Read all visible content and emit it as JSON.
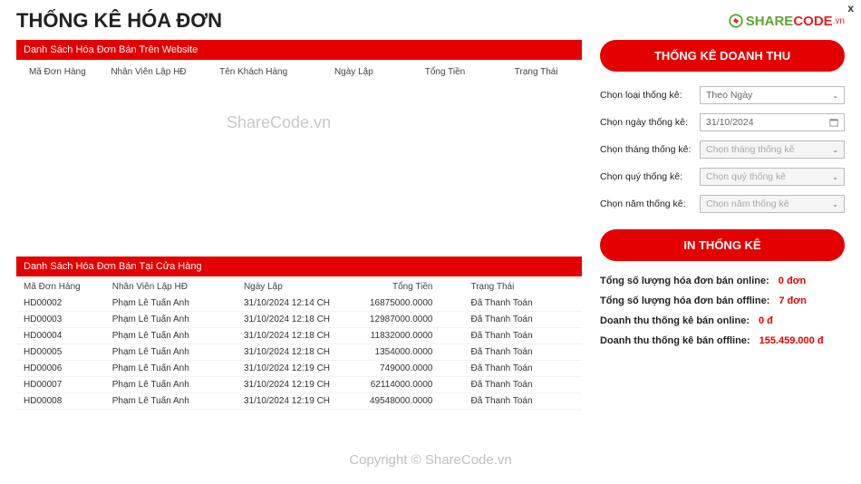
{
  "header": {
    "title": "THỐNG KÊ HÓA ĐƠN",
    "logo_green": "SHARE",
    "logo_red": "CODE",
    "logo_vn": ".vn"
  },
  "online_section": {
    "title": "Danh Sách Hóa Đơn Bán Trên Website",
    "columns": [
      "Mã Đơn Hàng",
      "Nhân Viên Lập HĐ",
      "Tên Khách Hàng",
      "Ngày Lập",
      "Tổng Tiền",
      "Trạng Thái"
    ]
  },
  "offline_section": {
    "title": "Danh Sách Hóa Đơn Bán Tại Cửa Hàng",
    "columns": [
      "Mã Đơn Hàng",
      "Nhân Viên Lập HĐ",
      "Ngày Lập",
      "Tổng Tiền",
      "Trạng Thái"
    ],
    "rows": [
      {
        "id": "HD00002",
        "staff": "Phạm Lê Tuấn Anh",
        "date": "31/10/2024 12:14 CH",
        "total": "16875000.0000",
        "status": "Đã Thanh Toán"
      },
      {
        "id": "HD00003",
        "staff": "Phạm Lê Tuấn Anh",
        "date": "31/10/2024 12:18 CH",
        "total": "12987000.0000",
        "status": "Đã Thanh Toán"
      },
      {
        "id": "HD00004",
        "staff": "Phạm Lê Tuấn Anh",
        "date": "31/10/2024 12:18 CH",
        "total": "11832000.0000",
        "status": "Đã Thanh Toán"
      },
      {
        "id": "HD00005",
        "staff": "Phạm Lê Tuấn Anh",
        "date": "31/10/2024 12:18 CH",
        "total": "1354000.0000",
        "status": "Đã Thanh Toán"
      },
      {
        "id": "HD00006",
        "staff": "Phạm Lê Tuấn Anh",
        "date": "31/10/2024 12:19 CH",
        "total": "749000.0000",
        "status": "Đã Thanh Toán"
      },
      {
        "id": "HD00007",
        "staff": "Phạm Lê Tuấn Anh",
        "date": "31/10/2024 12:19 CH",
        "total": "62114000.0000",
        "status": "Đã Thanh Toán"
      },
      {
        "id": "HD00008",
        "staff": "Phạm Lê Tuấn Anh",
        "date": "31/10/2024 12:19 CH",
        "total": "49548000.0000",
        "status": "Đã Thanh Toán"
      }
    ]
  },
  "right": {
    "btn_stats": "THỐNG KÊ DOANH THU",
    "btn_print": "IN THỐNG KÊ",
    "filters": {
      "type_label": "Chọn loại thống kê:",
      "type_value": "Theo Ngày",
      "date_label": "Chọn ngày thống kê:",
      "date_value": "31/10/2024",
      "month_label": "Chọn tháng thống kê:",
      "month_placeholder": "Chọn tháng thống kê",
      "quarter_label": "Chọn quý thống kê:",
      "quarter_placeholder": "Chọn quý thống kê",
      "year_label": "Chọn năm thống kê:",
      "year_placeholder": "Chọn năm thống kê"
    },
    "summary": {
      "online_count_label": "Tổng số lượng hóa đơn bán online:",
      "online_count_value": "0 đơn",
      "offline_count_label": "Tổng số lượng hóa đơn bán offline:",
      "offline_count_value": "7 đơn",
      "online_rev_label": "Doanh thu thống kê bán online:",
      "online_rev_value": "0 đ",
      "offline_rev_label": "Doanh thu thống kê bán offline:",
      "offline_rev_value": "155.459.000 đ"
    }
  },
  "watermark": "ShareCode.vn",
  "watermark2": "Copyright © ShareCode.vn"
}
